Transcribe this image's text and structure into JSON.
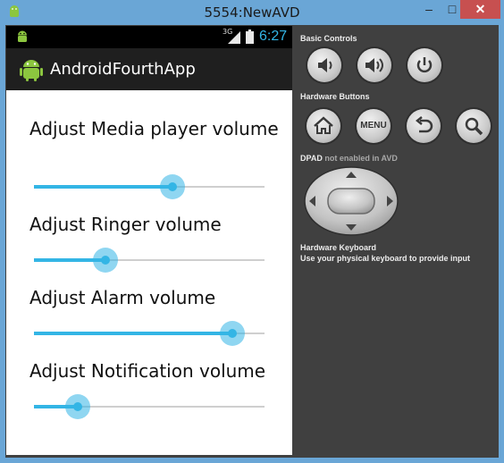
{
  "window": {
    "title": "5554:NewAVD",
    "minimize": "–",
    "maximize": "□",
    "close": "✕"
  },
  "statusbar": {
    "network": "3G",
    "time": "6:27"
  },
  "actionbar": {
    "title": "AndroidFourthApp"
  },
  "sliders": [
    {
      "label": "Adjust Media player volume",
      "value": 0.6
    },
    {
      "label": "Adjust Ringer volume",
      "value": 0.31
    },
    {
      "label": "Adjust Alarm volume",
      "value": 0.86
    },
    {
      "label": "Adjust Notification volume",
      "value": 0.19
    }
  ],
  "controls": {
    "basic_controls_label": "Basic Controls",
    "hardware_buttons_label": "Hardware Buttons",
    "menu_label": "MENU",
    "dpad_label": "DPAD",
    "dpad_note": "not enabled in AVD",
    "keyboard_title": "Hardware Keyboard",
    "keyboard_note": "Use your physical keyboard to provide input"
  },
  "colors": {
    "accent": "#33b5e5",
    "titlebar": "#6aa6d6",
    "panel": "#404040",
    "actionbar": "#1f1f1f"
  },
  "icons": [
    "android-icon",
    "signal-icon",
    "battery-icon",
    "volume-down-icon",
    "volume-up-icon",
    "power-icon",
    "home-icon",
    "back-icon",
    "search-icon",
    "dpad-up-icon",
    "dpad-down-icon",
    "dpad-left-icon",
    "dpad-right-icon"
  ]
}
